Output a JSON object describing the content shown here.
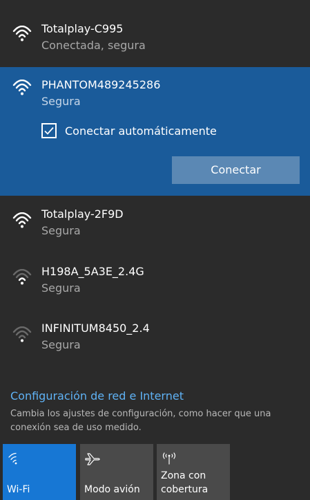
{
  "networks": [
    {
      "ssid": "Totalplay-C995",
      "status": "Conectada, segura",
      "signal": 4,
      "selected": false
    },
    {
      "ssid": "PHANTOM489245286",
      "status": "Segura",
      "signal": 4,
      "selected": true
    },
    {
      "ssid": "Totalplay-2F9D",
      "status": "Segura",
      "signal": 4,
      "selected": false
    },
    {
      "ssid": "H198A_5A3E_2.4G",
      "status": "Segura",
      "signal": 2,
      "selected": false
    },
    {
      "ssid": "INFINITUM8450_2.4",
      "status": "Segura",
      "signal": 1,
      "selected": false
    }
  ],
  "selected_network": {
    "auto_connect_label": "Conectar automáticamente",
    "auto_connect_checked": true,
    "connect_label": "Conectar"
  },
  "settings": {
    "link": "Configuración de red e Internet",
    "description": "Cambia los ajustes de configuración, como hacer que una conexión sea de uso medido."
  },
  "quick_actions": [
    {
      "label": "Wi-Fi",
      "icon": "wifi-icon",
      "active": true
    },
    {
      "label": "Modo avión",
      "icon": "airplane-icon",
      "active": false
    },
    {
      "label": "Zona con cobertura",
      "icon": "hotspot-icon",
      "active": false
    }
  ],
  "colors": {
    "flyout_background": "#2b2b2b",
    "selected_background": "#1a5b9a",
    "connect_button": "#5b88b4",
    "link": "#5fb2f5",
    "active_tile": "#1777d4",
    "inactive_tile": "#4a4a4a"
  }
}
